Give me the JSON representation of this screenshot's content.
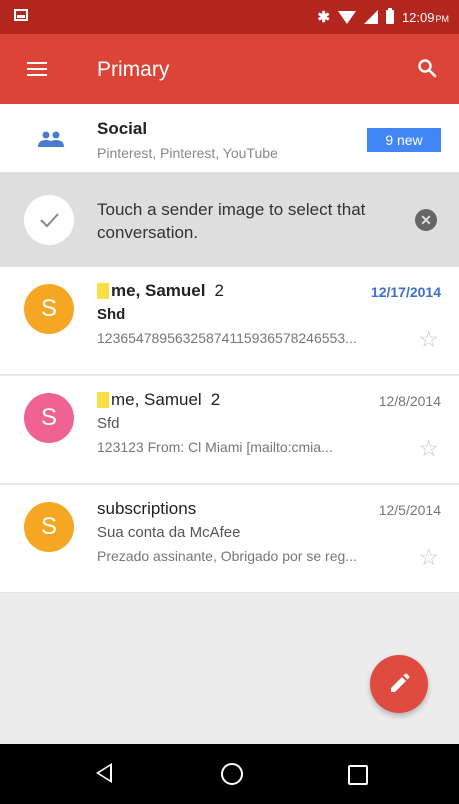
{
  "status_bar": {
    "time": "12:09",
    "ampm": "PM",
    "icons": [
      "notification-icon",
      "bluetooth-icon",
      "wifi-icon",
      "signal-icon",
      "battery-icon"
    ]
  },
  "app_bar": {
    "title": "Primary",
    "menu_icon": "menu-icon",
    "search_icon": "search-icon"
  },
  "social": {
    "title": "Social",
    "subtitle": "Pinterest, Pinterest, YouTube",
    "badge": "9 new"
  },
  "tip": {
    "text": "Touch a sender image to select that conversation."
  },
  "emails": [
    {
      "avatar_letter": "S",
      "avatar_color": "#f5a623",
      "sender": "me, Samuel",
      "count": "2",
      "date": "12/17/2014",
      "subject": "Shd",
      "snippet": "12365478956325874115936578246553...",
      "unread": true,
      "label": true
    },
    {
      "avatar_letter": "S",
      "avatar_color": "#f06292",
      "sender": "me, Samuel",
      "count": "2",
      "date": "12/8/2014",
      "subject": "Sfd",
      "snippet": "123123 From: Cl Miami [mailto:cmia...",
      "unread": false,
      "label": true
    },
    {
      "avatar_letter": "S",
      "avatar_color": "#f5a623",
      "sender": "subscriptions",
      "count": "",
      "date": "12/5/2014",
      "subject": "Sua conta da McAfee",
      "snippet": "Prezado assinante, Obrigado por se reg...",
      "unread": false,
      "label": false
    }
  ],
  "colors": {
    "status_bar": "#b3261e",
    "app_bar": "#db4437",
    "badge": "#4285f4",
    "fab": "#df4b3e",
    "date_highlight": "#3b6ecf"
  }
}
